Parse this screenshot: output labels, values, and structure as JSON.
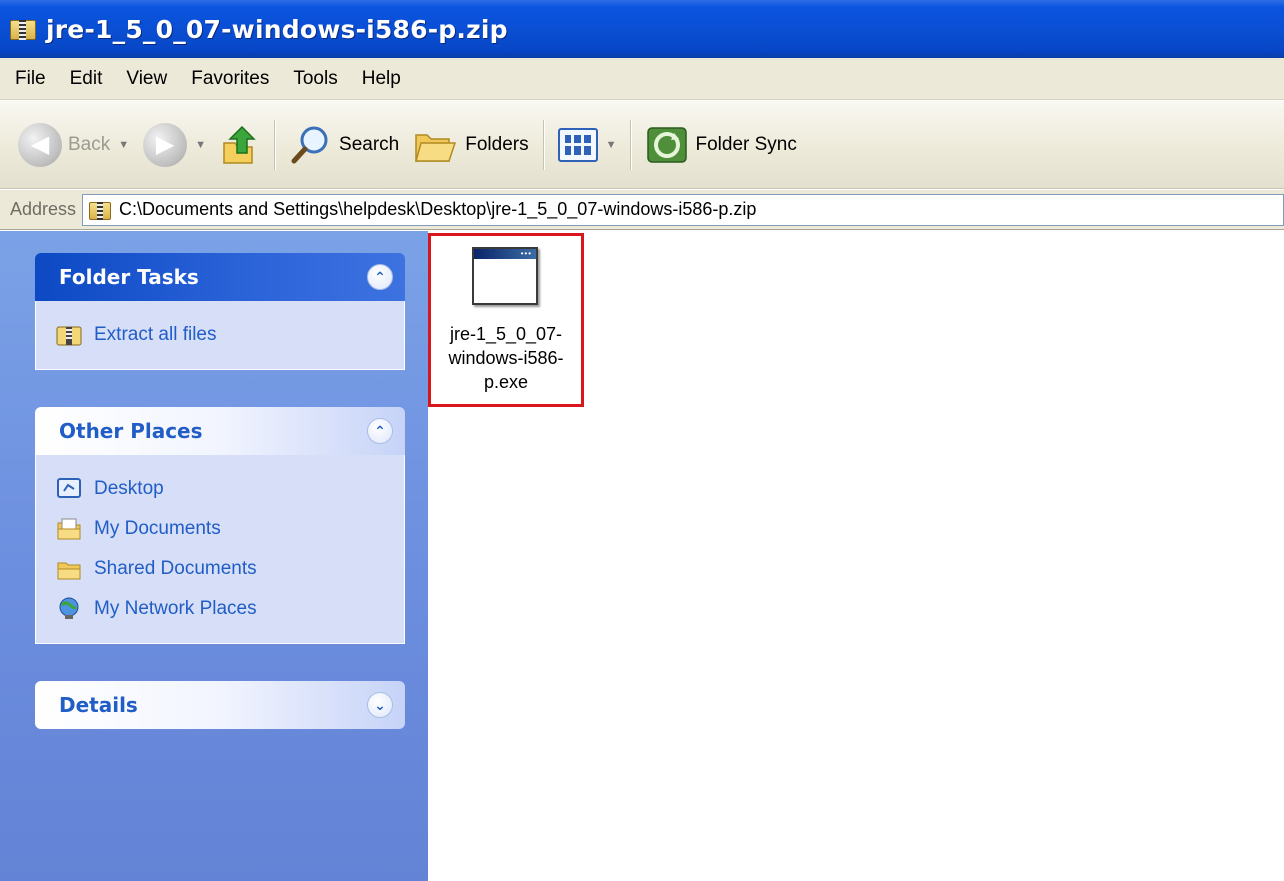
{
  "window": {
    "title": "jre-1_5_0_07-windows-i586-p.zip"
  },
  "menu": [
    "File",
    "Edit",
    "View",
    "Favorites",
    "Tools",
    "Help"
  ],
  "toolbar": {
    "back_label": "Back",
    "search_label": "Search",
    "folders_label": "Folders",
    "folder_sync_label": "Folder Sync"
  },
  "address": {
    "label": "Address",
    "path": "C:\\Documents and Settings\\helpdesk\\Desktop\\jre-1_5_0_07-windows-i586-p.zip"
  },
  "sidebar": {
    "folder_tasks": {
      "title": "Folder Tasks",
      "items": [
        {
          "label": "Extract all files",
          "icon": "zip-folder-icon"
        }
      ]
    },
    "other_places": {
      "title": "Other Places",
      "items": [
        {
          "label": "Desktop",
          "icon": "desktop-icon"
        },
        {
          "label": "My Documents",
          "icon": "my-documents-icon"
        },
        {
          "label": "Shared Documents",
          "icon": "shared-documents-icon"
        },
        {
          "label": "My Network Places",
          "icon": "network-places-icon"
        }
      ]
    },
    "details": {
      "title": "Details"
    }
  },
  "files": [
    {
      "name_lines": [
        "jre-1_5_0_07-",
        "windows-i586-",
        "p.exe"
      ],
      "icon": "application-window-icon"
    }
  ],
  "colors": {
    "title_bar": "#0a4ed2",
    "highlight_border": "#d9161b",
    "sidebar_link": "#215dc6"
  }
}
